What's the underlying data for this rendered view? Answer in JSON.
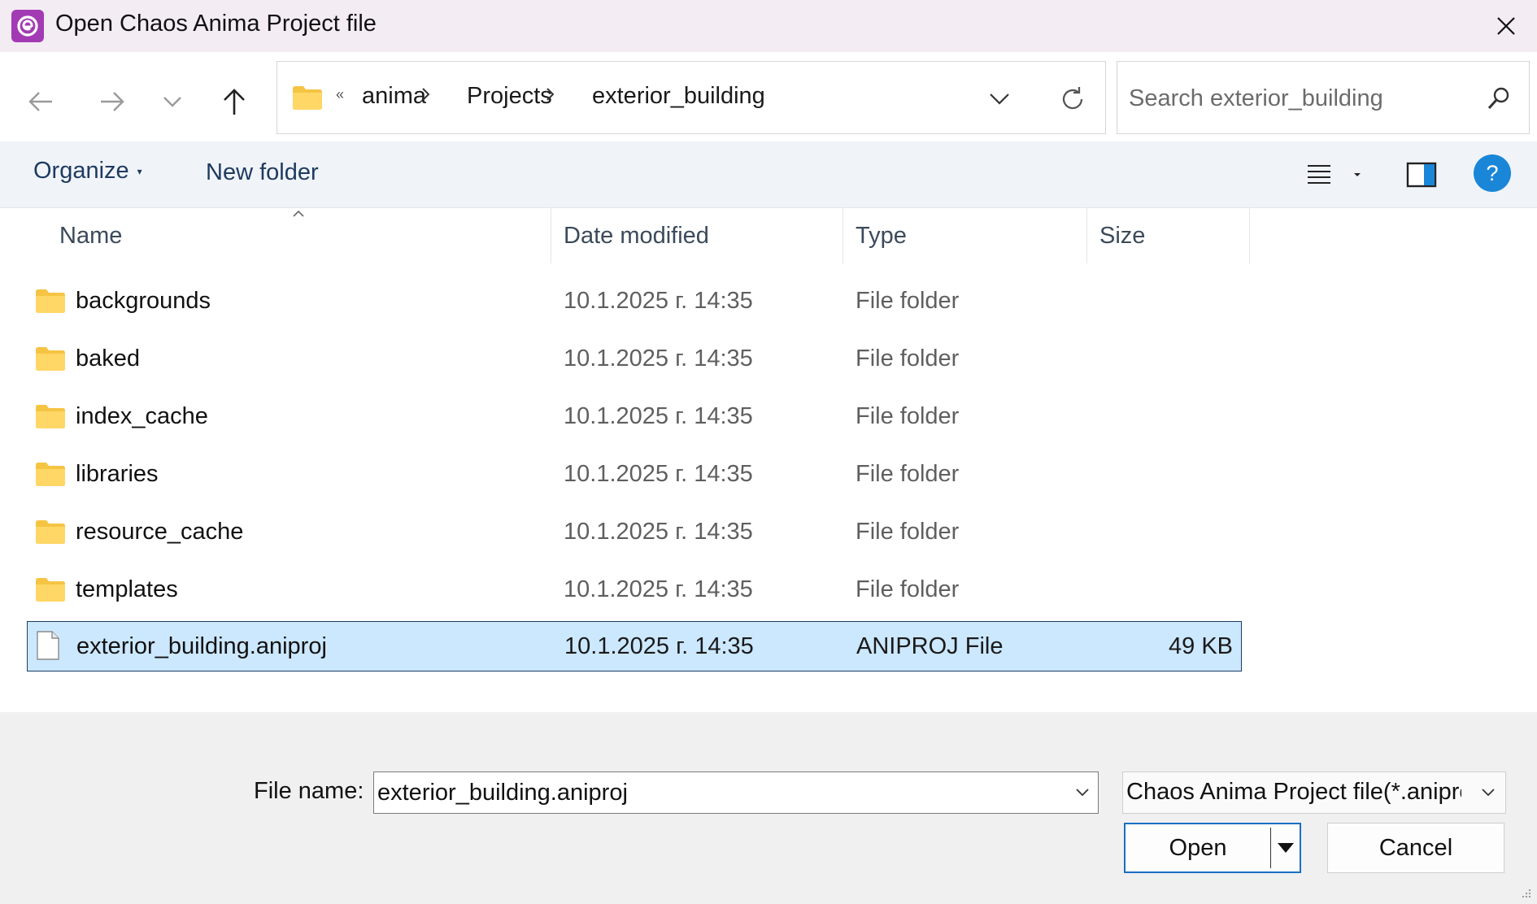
{
  "window": {
    "title": "Open Chaos Anima Project file",
    "app_icon": "anima-logo-icon",
    "accent_color": "#a23bb3"
  },
  "nav": {
    "back_icon": "arrow-left-icon",
    "forward_icon": "arrow-right-icon",
    "recent_icon": "chevron-down-icon",
    "up_icon": "arrow-up-icon"
  },
  "address": {
    "overflow_glyph": "«",
    "crumbs": [
      "anima",
      "Projects",
      "exterior_building"
    ]
  },
  "search": {
    "placeholder": "Search exterior_building"
  },
  "toolbar": {
    "organize_label": "Organize",
    "new_folder_label": "New folder",
    "help_label": "?"
  },
  "columns": {
    "name": "Name",
    "date": "Date modified",
    "type": "Type",
    "size": "Size"
  },
  "files": [
    {
      "name": "backgrounds",
      "date": "10.1.2025 г. 14:35",
      "type": "File folder",
      "size": "",
      "icon": "folder-icon"
    },
    {
      "name": "baked",
      "date": "10.1.2025 г. 14:35",
      "type": "File folder",
      "size": "",
      "icon": "folder-icon"
    },
    {
      "name": "index_cache",
      "date": "10.1.2025 г. 14:35",
      "type": "File folder",
      "size": "",
      "icon": "folder-icon"
    },
    {
      "name": "libraries",
      "date": "10.1.2025 г. 14:35",
      "type": "File folder",
      "size": "",
      "icon": "folder-icon"
    },
    {
      "name": "resource_cache",
      "date": "10.1.2025 г. 14:35",
      "type": "File folder",
      "size": "",
      "icon": "folder-icon"
    },
    {
      "name": "templates",
      "date": "10.1.2025 г. 14:35",
      "type": "File folder",
      "size": "",
      "icon": "folder-icon"
    },
    {
      "name": "exterior_building.aniproj",
      "date": "10.1.2025 г. 14:35",
      "type": "ANIPROJ File",
      "size": "49 KB",
      "icon": "file-icon",
      "selected": true
    }
  ],
  "footer": {
    "file_name_label": "File name:",
    "file_name_value": "exterior_building.aniproj",
    "file_type_value": "Chaos Anima Project file(*.aniproj)",
    "open_label": "Open",
    "cancel_label": "Cancel"
  }
}
